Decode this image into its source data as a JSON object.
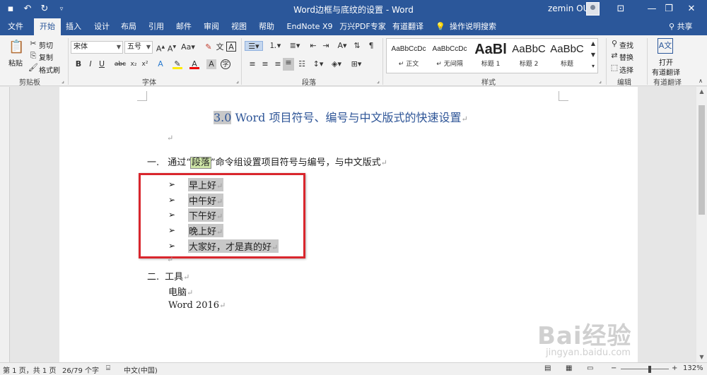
{
  "titlebar": {
    "title": "Word边框与底纹的设置 - Word",
    "user": "zemin OU",
    "qat_icons": [
      "save-icon",
      "undo-icon",
      "redo-icon",
      "customize-icon"
    ]
  },
  "tabs": [
    {
      "label": "文件"
    },
    {
      "label": "开始"
    },
    {
      "label": "插入"
    },
    {
      "label": "设计"
    },
    {
      "label": "布局"
    },
    {
      "label": "引用"
    },
    {
      "label": "邮件"
    },
    {
      "label": "审阅"
    },
    {
      "label": "视图"
    },
    {
      "label": "帮助"
    },
    {
      "label": "EndNote X9"
    },
    {
      "label": "万兴PDF专家"
    },
    {
      "label": "有道翻译"
    },
    {
      "label": "操作说明搜索"
    }
  ],
  "share_label": "共享",
  "ribbon": {
    "clipboard": {
      "paste": "粘贴",
      "cut": "剪切",
      "copy": "复制",
      "format_painter": "格式刷",
      "label": "剪贴板"
    },
    "font": {
      "font_name": "宋体",
      "font_size": "五号",
      "label": "字体"
    },
    "paragraph": {
      "label": "段落"
    },
    "styles": {
      "items": [
        {
          "sample": "AaBbCcDc",
          "name": "↵ 正文"
        },
        {
          "sample": "AaBbCcDc",
          "name": "↵ 无间隔"
        },
        {
          "sample": "AaBl",
          "name": "标题 1"
        },
        {
          "sample": "AaBbC",
          "name": "标题 2"
        },
        {
          "sample": "AaBbC",
          "name": "标题"
        }
      ],
      "label": "样式"
    },
    "editing": {
      "find": "查找",
      "replace": "替换",
      "select": "选择",
      "label": "编辑"
    },
    "youdao": {
      "open": "打开",
      "name": "有道翻译",
      "label": "有道翻译"
    }
  },
  "document": {
    "heading_num": "3.0",
    "heading_text": " Word 项目符号、编号与中文版式的快速设置",
    "item1_num": "一.",
    "item1_pre": "通过“",
    "item1_hl": "段落",
    "item1_post": "”命令组设置项目符号与编号，与中文版式",
    "bullets": [
      "早上好",
      "中午好",
      "下午好",
      "晚上好",
      "大家好，才是真的好"
    ],
    "bullet_symbol": "➢",
    "item2_num": "二.",
    "item2_text": "工具",
    "line_computer": "电脑",
    "line_word": "Word 2016",
    "para_mark": "↵"
  },
  "watermark": {
    "logo": "Bai经验",
    "url": "jingyan.baidu.com"
  },
  "statusbar": {
    "page": "第 1 页，共 1 页",
    "words": "26/79 个字",
    "language": "中文(中国)",
    "zoom": "132%",
    "zoom_level": 0.6
  }
}
